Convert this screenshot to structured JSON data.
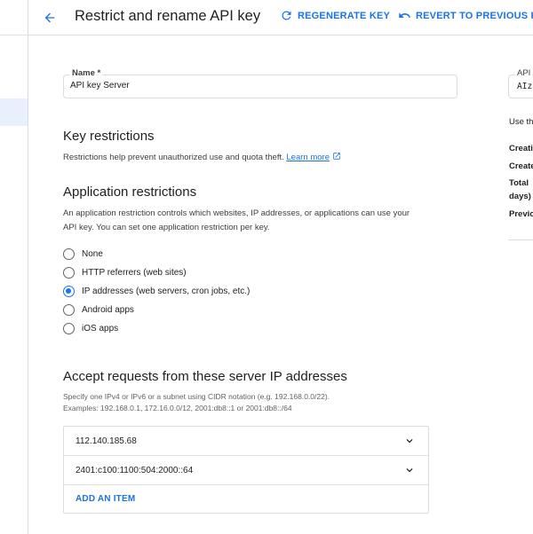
{
  "header": {
    "title": "Restrict and rename API key",
    "regenerate_label": "REGENERATE KEY",
    "revert_label": "REVERT TO PREVIOUS KEY"
  },
  "name_field": {
    "label": "Name *",
    "value": "API key Server"
  },
  "key_restrictions": {
    "heading": "Key restrictions",
    "description": "Restrictions help prevent unauthorized use and quota theft.",
    "learn_more": "Learn more"
  },
  "application_restrictions": {
    "heading": "Application restrictions",
    "description_line1": "An application restriction controls which websites, IP addresses, or applications can use your",
    "description_line2": "API key. You can set one application restriction per key.",
    "options": [
      {
        "label": "None",
        "checked": false
      },
      {
        "label": "HTTP referrers (web sites)",
        "checked": false
      },
      {
        "label": "IP addresses (web servers, cron jobs, etc.)",
        "checked": true
      },
      {
        "label": "Android apps",
        "checked": false
      },
      {
        "label": "iOS apps",
        "checked": false
      }
    ]
  },
  "ip_section": {
    "heading": "Accept requests from these server IP addresses",
    "hint_line1": "Specify one IPv4 or IPv6 or a subnet using CIDR notation (e.g. 192.168.0.0/22).",
    "hint_line2": "Examples: 192.168.0.1, 172.16.0.0/12, 2001:db8::1 or 2001:db8::/64",
    "items": [
      "112.140.185.68",
      "2401:c100:1100:504:2000::64"
    ],
    "add_label": "ADD AN ITEM"
  },
  "right_panel": {
    "field_label": "API",
    "field_value": "AIz",
    "use_text": "Use th",
    "creation_label": "Creati",
    "created_by_label": "Create",
    "total_label_1": "Total",
    "total_label_2": "days)",
    "previous_label": "Previo"
  },
  "colors": {
    "accent": "#1a73e8",
    "border": "#dadce0",
    "text": "#202124",
    "selected_nav": "#e8f0fe"
  }
}
